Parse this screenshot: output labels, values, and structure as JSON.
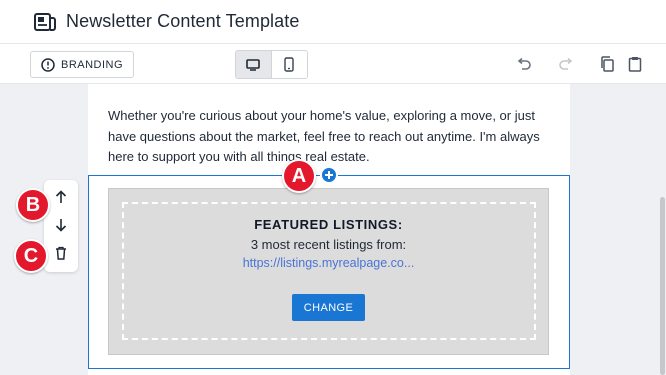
{
  "app": {
    "title": "Newsletter Content Template",
    "icon": "newspaper-icon"
  },
  "toolbar": {
    "branding_label": "BRANDING",
    "branding_icon": "palette-icon",
    "devices": [
      {
        "name": "desktop",
        "icon": "desktop-icon",
        "active": true
      },
      {
        "name": "mobile",
        "icon": "mobile-icon",
        "active": false
      }
    ],
    "actions": [
      "undo-icon",
      "redo-icon",
      "copy-icon",
      "paste-icon"
    ]
  },
  "content": {
    "paragraph": "Whether you're curious about your home's value, exploring a move, or just have questions about the market, feel free to reach out anytime. I'm always here to support you with all things real estate."
  },
  "listings_block": {
    "title": "FEATURED LISTINGS:",
    "subtitle": "3 most recent listings from:",
    "link": "https://listings.myrealpage.co...",
    "button_label": "CHANGE"
  },
  "block_controls": [
    "arrow-up-icon",
    "arrow-down-icon",
    "trash-icon"
  ],
  "markers": {
    "a": "A",
    "b": "B",
    "c": "C"
  },
  "colors": {
    "accent": "#1976d2",
    "marker": "#e3182d",
    "link": "#4a74d6"
  }
}
